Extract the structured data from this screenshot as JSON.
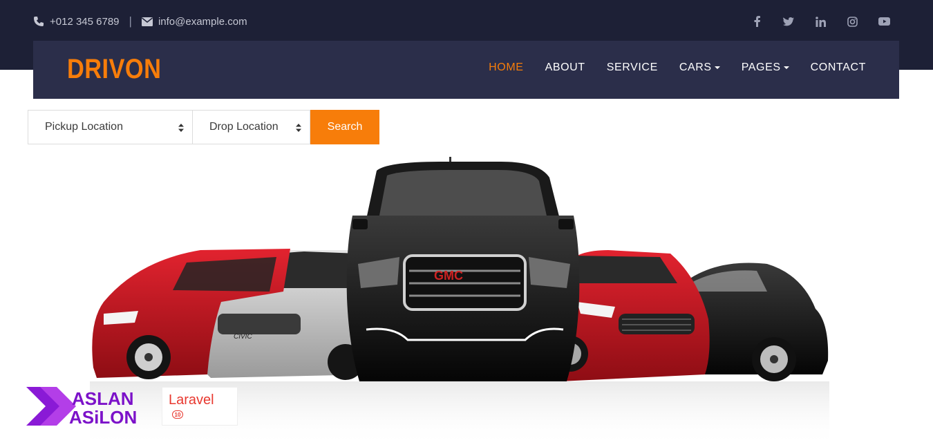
{
  "topbar": {
    "phone": "+012 345 6789",
    "separator": "|",
    "email": "info@example.com",
    "social": [
      "facebook-icon",
      "twitter-icon",
      "linkedin-icon",
      "instagram-icon",
      "youtube-icon"
    ]
  },
  "navbar": {
    "logo": "DRIVON",
    "menu": [
      {
        "label": "HOME",
        "active": true
      },
      {
        "label": "ABOUT"
      },
      {
        "label": "SERVICE"
      },
      {
        "label": "CARS",
        "dropdown": true
      },
      {
        "label": "PAGES",
        "dropdown": true
      },
      {
        "label": "CONTACT"
      }
    ]
  },
  "search": {
    "pickup_value": "Pickup Location",
    "drop_value": "Drop Location",
    "button_label": "Search"
  },
  "hero": {
    "grille_text": "GMC",
    "honda_badge": "CIVIC"
  },
  "badges": {
    "aslan_line1": "ASLAN",
    "aslan_line2": "ASiLON",
    "laravel_text": "Laravel",
    "laravel_version": "10"
  },
  "colors": {
    "topbar_bg": "#1d2036",
    "navbar_bg": "#2b2e4a",
    "accent": "#f77d0a",
    "text_light": "#c6c8d4"
  }
}
